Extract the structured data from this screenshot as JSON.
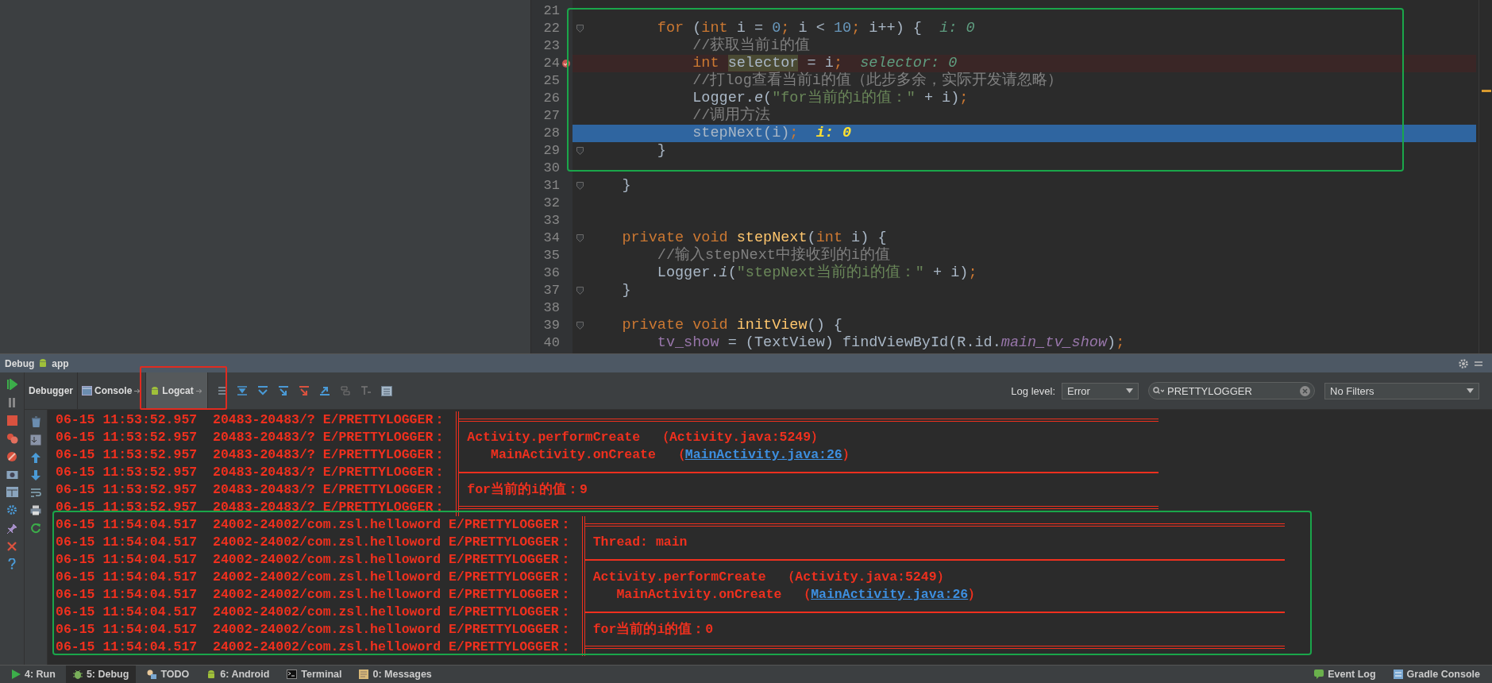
{
  "editor": {
    "lines": [
      {
        "number": "21",
        "kind": "plain",
        "fold": false
      },
      {
        "number": "22",
        "kind": "plain",
        "fold": true,
        "tokens": [
          {
            "kind": "kw",
            "s": "        for"
          },
          {
            "kind": "plain",
            "s": " ("
          },
          {
            "kind": "kw",
            "s": "int"
          },
          {
            "kind": "plain",
            "s": " i = "
          },
          {
            "kind": "num",
            "s": "0"
          },
          {
            "kind": "kw",
            "s": ";"
          },
          {
            "kind": "plain",
            "s": " i < "
          },
          {
            "kind": "num",
            "s": "10"
          },
          {
            "kind": "kw",
            "s": ";"
          },
          {
            "kind": "plain",
            "s": " i++) {"
          },
          {
            "kind": "hint",
            "s": "  i: 0"
          }
        ]
      },
      {
        "number": "23",
        "kind": "plain",
        "fold": false,
        "tokens": [
          {
            "kind": "comment",
            "s": "            //获取当前i的值"
          }
        ]
      },
      {
        "number": "24",
        "kind": "breakpoint",
        "fold": false,
        "tokens": [
          {
            "kind": "kw",
            "s": "            int "
          },
          {
            "kind": "mark",
            "s": "selector"
          },
          {
            "kind": "plain",
            "s": " = i"
          },
          {
            "kind": "kw",
            "s": ";"
          },
          {
            "kind": "hint",
            "s": "  selector: 0"
          }
        ]
      },
      {
        "number": "25",
        "kind": "plain",
        "fold": false,
        "tokens": [
          {
            "kind": "comment",
            "s": "            //打log查看当前i的值（此步多余，实际开发请忽略）"
          }
        ]
      },
      {
        "number": "26",
        "kind": "plain",
        "fold": false,
        "tokens": [
          {
            "kind": "plain",
            "s": "            Logger."
          },
          {
            "kind": "italic",
            "s": "e"
          },
          {
            "kind": "plain",
            "s": "("
          },
          {
            "kind": "str",
            "s": "\"for当前的i的值：\""
          },
          {
            "kind": "plain",
            "s": " + i)"
          },
          {
            "kind": "kw",
            "s": ";"
          }
        ]
      },
      {
        "number": "27",
        "kind": "plain",
        "fold": false,
        "tokens": [
          {
            "kind": "comment",
            "s": "            //调用方法"
          }
        ]
      },
      {
        "number": "28",
        "kind": "execution",
        "fold": false,
        "tokens": [
          {
            "kind": "plain",
            "s": "            stepNext(i)"
          },
          {
            "kind": "kw",
            "s": ";"
          },
          {
            "kind": "hint-exec",
            "s": "  i: 0"
          }
        ]
      },
      {
        "number": "29",
        "kind": "plain",
        "fold": true,
        "tokens": [
          {
            "kind": "plain",
            "s": "        }"
          }
        ]
      },
      {
        "number": "30",
        "kind": "plain",
        "fold": false
      },
      {
        "number": "31",
        "kind": "plain",
        "fold": true,
        "tokens": [
          {
            "kind": "plain",
            "s": "    }"
          }
        ]
      },
      {
        "number": "32",
        "kind": "plain",
        "fold": false
      },
      {
        "number": "33",
        "kind": "plain",
        "fold": false
      },
      {
        "number": "34",
        "kind": "plain",
        "fold": true,
        "tokens": [
          {
            "kind": "kw",
            "s": "    private void "
          },
          {
            "kind": "fn",
            "s": "stepNext"
          },
          {
            "kind": "plain",
            "s": "("
          },
          {
            "kind": "kw",
            "s": "int"
          },
          {
            "kind": "plain",
            "s": " i) {"
          }
        ]
      },
      {
        "number": "35",
        "kind": "plain",
        "fold": false,
        "tokens": [
          {
            "kind": "comment",
            "s": "        //输入stepNext中接收到的i的值"
          }
        ]
      },
      {
        "number": "36",
        "kind": "plain",
        "fold": false,
        "tokens": [
          {
            "kind": "plain",
            "s": "        Logger."
          },
          {
            "kind": "italic",
            "s": "i"
          },
          {
            "kind": "plain",
            "s": "("
          },
          {
            "kind": "str",
            "s": "\"stepNext当前的i的值：\""
          },
          {
            "kind": "plain",
            "s": " + i)"
          },
          {
            "kind": "kw",
            "s": ";"
          }
        ]
      },
      {
        "number": "37",
        "kind": "plain",
        "fold": true,
        "tokens": [
          {
            "kind": "plain",
            "s": "    }"
          }
        ]
      },
      {
        "number": "38",
        "kind": "plain",
        "fold": false
      },
      {
        "number": "39",
        "kind": "plain",
        "fold": true,
        "tokens": [
          {
            "kind": "kw",
            "s": "    private void "
          },
          {
            "kind": "fn",
            "s": "initView"
          },
          {
            "kind": "plain",
            "s": "() {"
          }
        ]
      },
      {
        "number": "40",
        "kind": "plain",
        "fold": false,
        "tokens": [
          {
            "kind": "field",
            "s": "        tv_show"
          },
          {
            "kind": "plain",
            "s": " = (TextView) findViewById(R.id."
          },
          {
            "kind": "field-italic",
            "s": "main_tv_show"
          },
          {
            "kind": "plain",
            "s": ")"
          },
          {
            "kind": "kw",
            "s": ";"
          }
        ]
      }
    ]
  },
  "debug_panel": {
    "title": "Debug",
    "config": "app",
    "tabs": [
      {
        "label": "Debugger",
        "selected": false
      },
      {
        "label": "Console",
        "selected": false
      },
      {
        "label": "Logcat",
        "selected": true
      }
    ],
    "log_level_label": "Log level:",
    "log_level": "Error",
    "search": {
      "value": "PRETTYLOGGER"
    },
    "filter": "No Filters"
  },
  "log_rows": [
    {
      "prefix": "06-15 11:53:52.957  20483-20483/? E/PRETTYLOGGER：",
      "kind": "top"
    },
    {
      "prefix": "06-15 11:53:52.957  20483-20483/? E/PRETTYLOGGER：",
      "kind": "text",
      "text": "Activity.performCreate  （Activity.java:5249）"
    },
    {
      "prefix": "06-15 11:53:52.957  20483-20483/? E/PRETTYLOGGER：",
      "kind": "text",
      "text": "   MainActivity.onCreate  （",
      "link": "MainActivity.java:26",
      "after": "）"
    },
    {
      "prefix": "06-15 11:53:52.957  20483-20483/? E/PRETTYLOGGER：",
      "kind": "divider"
    },
    {
      "prefix": "06-15 11:53:52.957  20483-20483/? E/PRETTYLOGGER：",
      "kind": "text",
      "text": "for当前的i的值：9"
    },
    {
      "prefix": "06-15 11:53:52.957  20483-20483/? E/PRETTYLOGGER：",
      "kind": "bottom"
    },
    {
      "prefix": "06-15 11:54:04.517  24002-24002/com.zsl.helloword E/PRETTYLOGGER：",
      "kind": "top"
    },
    {
      "prefix": "06-15 11:54:04.517  24002-24002/com.zsl.helloword E/PRETTYLOGGER：",
      "kind": "text",
      "text": "Thread: main"
    },
    {
      "prefix": "06-15 11:54:04.517  24002-24002/com.zsl.helloword E/PRETTYLOGGER：",
      "kind": "divider"
    },
    {
      "prefix": "06-15 11:54:04.517  24002-24002/com.zsl.helloword E/PRETTYLOGGER：",
      "kind": "text",
      "text": "Activity.performCreate  （Activity.java:5249）"
    },
    {
      "prefix": "06-15 11:54:04.517  24002-24002/com.zsl.helloword E/PRETTYLOGGER：",
      "kind": "text",
      "text": "   MainActivity.onCreate  （",
      "link": "MainActivity.java:26",
      "after": "）"
    },
    {
      "prefix": "06-15 11:54:04.517  24002-24002/com.zsl.helloword E/PRETTYLOGGER：",
      "kind": "divider"
    },
    {
      "prefix": "06-15 11:54:04.517  24002-24002/com.zsl.helloword E/PRETTYLOGGER：",
      "kind": "text",
      "text": "for当前的i的值：0"
    },
    {
      "prefix": "06-15 11:54:04.517  24002-24002/com.zsl.helloword E/PRETTYLOGGER：",
      "kind": "bottom"
    }
  ],
  "status_bar": {
    "tools": [
      {
        "label": "4: Run",
        "selected": false
      },
      {
        "label": "5: Debug",
        "selected": true
      },
      {
        "label": "TODO",
        "selected": false
      },
      {
        "label": "6: Android",
        "selected": false
      },
      {
        "label": "Terminal",
        "selected": false
      },
      {
        "label": "0: Messages",
        "selected": false
      }
    ],
    "right": [
      "Event Log",
      "Gradle Console"
    ]
  }
}
